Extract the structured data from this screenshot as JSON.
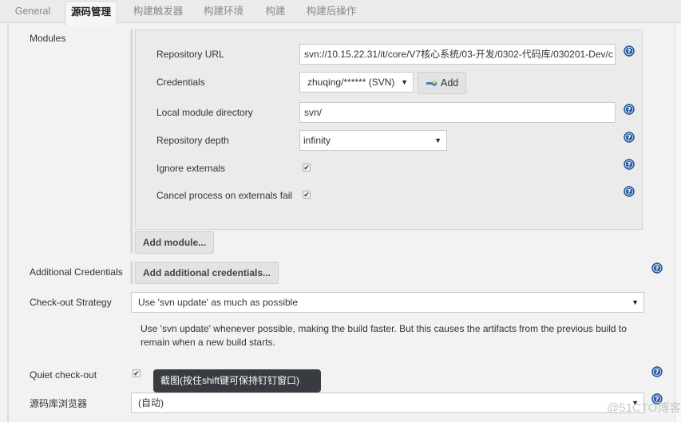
{
  "tabs": [
    {
      "label": "General",
      "active": false
    },
    {
      "label": "源码管理",
      "active": true
    },
    {
      "label": "构建触发器",
      "active": false
    },
    {
      "label": "构建环境",
      "active": false
    },
    {
      "label": "构建",
      "active": false
    },
    {
      "label": "构建后操作",
      "active": false
    }
  ],
  "modules": {
    "section_label": "Modules",
    "repository_url": {
      "label": "Repository URL",
      "value": "svn://10.15.22.31/it/core/V7核心系统/03-开发/0302-代码库/030201-Dev/c"
    },
    "credentials": {
      "label": "Credentials",
      "selected": "zhuqing/****** (SVN)",
      "add_button": "Add"
    },
    "local_module_directory": {
      "label": "Local module directory",
      "value": "svn/"
    },
    "repository_depth": {
      "label": "Repository depth",
      "selected": "infinity"
    },
    "ignore_externals": {
      "label": "Ignore externals",
      "checked": true
    },
    "cancel_process": {
      "label": "Cancel process on externals fail",
      "checked": true
    },
    "add_module_button": "Add module..."
  },
  "additional_credentials": {
    "label": "Additional Credentials",
    "button": "Add additional credentials..."
  },
  "checkout_strategy": {
    "label": "Check-out Strategy",
    "selected": "Use 'svn update' as much as possible",
    "description_line1": "Use 'svn update' whenever possible, making the build faster. But this causes the artifacts from the previous build to",
    "description_line2": "remain when a new build starts."
  },
  "quiet_checkout": {
    "label": "Quiet check-out",
    "checked": true
  },
  "repo_browser": {
    "label": "源码库浏览器",
    "selected": "(自动)"
  },
  "tooltip": "截图(按住shift键可保持钉钉窗口)",
  "watermark": "@51CTO博客",
  "colors": {
    "help_icon": "#2f63a8",
    "tooltip_bg": "#383b40"
  }
}
